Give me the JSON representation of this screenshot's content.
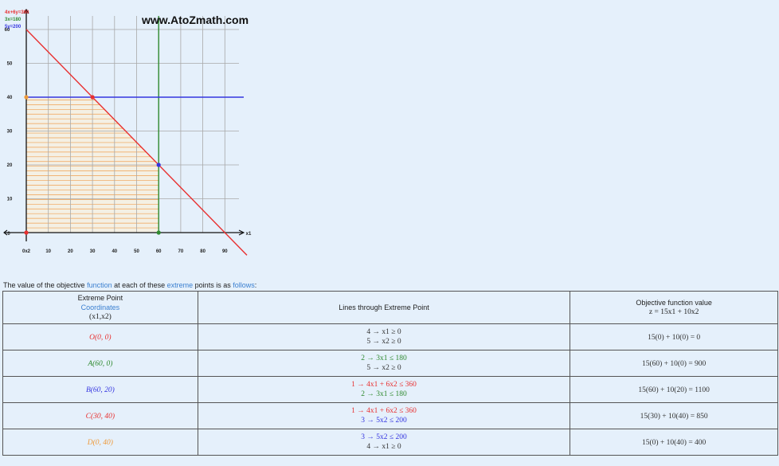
{
  "colors": {
    "red": "#e83030",
    "green": "#2f8a2f",
    "blue": "#3535e0",
    "orange": "#ee9a3a",
    "feasible_fill": "#f0a050",
    "grid": "#999999",
    "background": "#e5f0fb"
  },
  "chart_data": {
    "type": "line",
    "watermark": "www.AtoZmath.com",
    "xlabel": "x1",
    "origin_label": "0x2",
    "x_ticks": [
      10,
      20,
      30,
      40,
      50,
      60,
      70,
      80,
      90
    ],
    "y_ticks": [
      10,
      20,
      30,
      40,
      50
    ],
    "y_axis_top_label": "60",
    "x_axis_label_at_zero": "0",
    "xlim": [
      0,
      100
    ],
    "ylim": [
      0,
      64
    ],
    "grid": true,
    "feasible_region": [
      [
        0,
        0
      ],
      [
        60,
        0
      ],
      [
        60,
        20
      ],
      [
        30,
        40
      ],
      [
        0,
        40
      ]
    ],
    "series": [
      {
        "name": "4x+6y=360",
        "color": "#e83030",
        "x": [
          0,
          100
        ],
        "y": [
          60,
          -6.67
        ]
      },
      {
        "name": "3x=180",
        "color": "#2f8a2f",
        "x": [
          60,
          60
        ],
        "y": [
          0,
          64
        ]
      },
      {
        "name": "5y=200",
        "color": "#3535e0",
        "x": [
          0,
          100
        ],
        "y": [
          40,
          40
        ]
      }
    ],
    "points": [
      {
        "label": "O",
        "x": 0,
        "y": 0,
        "color": "#e83030"
      },
      {
        "label": "A",
        "x": 60,
        "y": 0,
        "color": "#2f8a2f"
      },
      {
        "label": "B",
        "x": 60,
        "y": 20,
        "color": "#3535e0"
      },
      {
        "label": "C",
        "x": 30,
        "y": 40,
        "color": "#e83030"
      },
      {
        "label": "D",
        "x": 0,
        "y": 40,
        "color": "#ee9a3a"
      }
    ],
    "corner_labels": [
      "4x+6y=360",
      "3x=180",
      "5y=200"
    ]
  },
  "sentence": {
    "p1": "The value of the objective ",
    "l1": "function",
    "p2": " at each of these ",
    "l2": "extreme",
    "p3": " points is as ",
    "l3": "follows",
    ":": ":"
  },
  "table": {
    "h1": {
      "line1": "Extreme Point",
      "line2": "Coordinates",
      "line3": "(x1,x2)"
    },
    "h2": "Lines through Extreme Point",
    "h3": {
      "line1": "Objective function value",
      "line2": "z = 15x1 + 10x2"
    },
    "rows": [
      {
        "point": "O(0, 0)",
        "color": "c-red",
        "l1": "4 → x1 ≥ 0",
        "l1c": "c-black",
        "l2": "5 → x2 ≥ 0",
        "l2c": "c-black",
        "value": "15(0) + 10(0) = 0"
      },
      {
        "point": "A(60, 0)",
        "color": "c-green",
        "l1": "2 → 3x1 ≤ 180",
        "l1c": "c-green",
        "l2": "5 → x2 ≥ 0",
        "l2c": "c-black",
        "value": "15(60) + 10(0) = 900"
      },
      {
        "point": "B(60, 20)",
        "color": "c-blue",
        "l1": "1 → 4x1 + 6x2 ≤ 360",
        "l1c": "c-red",
        "l2": "2 → 3x1 ≤ 180",
        "l2c": "c-green",
        "value": "15(60) + 10(20) = 1100"
      },
      {
        "point": "C(30, 40)",
        "color": "c-red",
        "l1": "1 → 4x1 + 6x2 ≤ 360",
        "l1c": "c-red",
        "l2": "3 → 5x2 ≤ 200",
        "l2c": "c-blue",
        "value": "15(30) + 10(40) = 850"
      },
      {
        "point": "D(0, 40)",
        "color": "c-orange",
        "l1": "3 → 5x2 ≤ 200",
        "l1c": "c-blue",
        "l2": "4 → x1 ≥ 0",
        "l2c": "c-black",
        "value": "15(0) + 10(40) = 400"
      }
    ]
  }
}
